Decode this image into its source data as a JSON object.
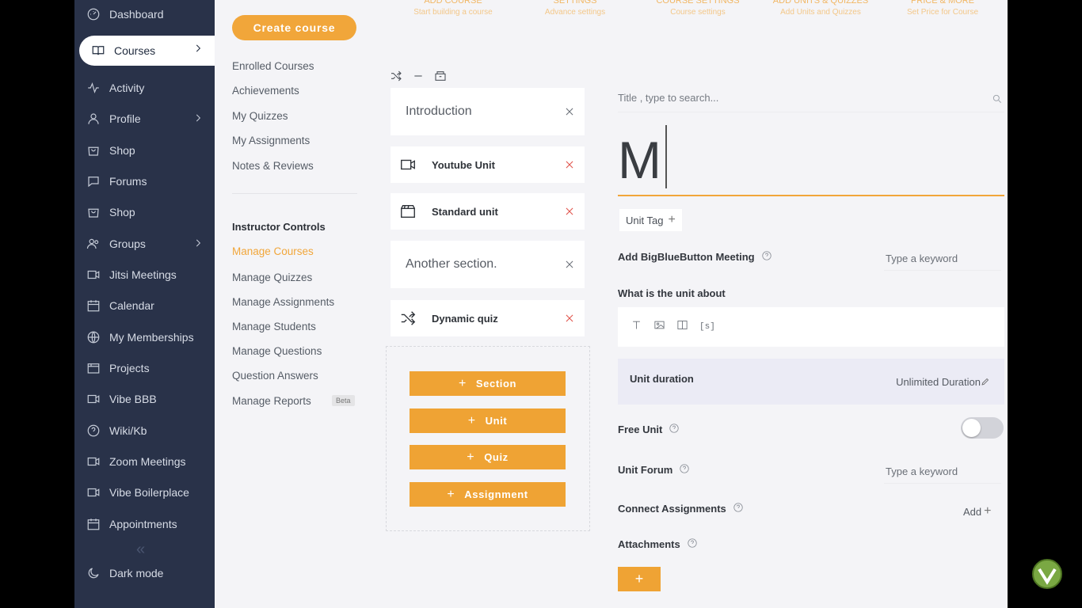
{
  "sidebar": {
    "items": [
      {
        "label": "Dashboard",
        "icon": "dashboard-icon"
      },
      {
        "label": "Courses",
        "icon": "book-icon",
        "chevron": true,
        "active": true
      },
      {
        "label": "Activity",
        "icon": "activity-icon"
      },
      {
        "label": "Profile",
        "icon": "user-icon",
        "chevron": true
      },
      {
        "label": "Shop",
        "icon": "shop-icon"
      },
      {
        "label": "Forums",
        "icon": "chat-icon"
      },
      {
        "label": "Shop",
        "icon": "shop-icon"
      },
      {
        "label": "Groups",
        "icon": "group-icon",
        "chevron": true
      },
      {
        "label": "Jitsi Meetings",
        "icon": "video-icon"
      },
      {
        "label": "Calendar",
        "icon": "calendar-icon"
      },
      {
        "label": "My Memberships",
        "icon": "globe-icon"
      },
      {
        "label": "Projects",
        "icon": "projects-icon"
      },
      {
        "label": "Vibe BBB",
        "icon": "video-icon"
      },
      {
        "label": "Wiki/Kb",
        "icon": "help-circle-icon"
      },
      {
        "label": "Zoom Meetings",
        "icon": "video-icon"
      },
      {
        "label": "Vibe Boilerplace",
        "icon": "video-icon"
      },
      {
        "label": "Appointments",
        "icon": "calendar-icon"
      }
    ],
    "collapse_glyph": "«",
    "dark_mode": "Dark mode"
  },
  "submenu": {
    "create_course": "Create course",
    "links": [
      "Enrolled Courses",
      "Achievements",
      "My Quizzes",
      "My Assignments",
      "Notes & Reviews"
    ],
    "instructor_heading": "Instructor Controls",
    "instructor_links": [
      "Manage Courses",
      "Manage Quizzes",
      "Manage Assignments",
      "Manage Students",
      "Manage Questions",
      "Question Answers",
      "Manage Reports"
    ],
    "active_link": "Manage Courses",
    "beta": "Beta"
  },
  "steps": [
    {
      "title": "ADD COURSE",
      "subtitle": "Start building a course"
    },
    {
      "title": "SETTINGS",
      "subtitle": "Advance settings"
    },
    {
      "title": "COURSE SETTINGS",
      "subtitle": "Course settings"
    },
    {
      "title": "ADD UNITS & QUIZZES",
      "subtitle": "Add Units and Quizzes"
    },
    {
      "title": "PRICE & MORE",
      "subtitle": "Set Price for Course"
    }
  ],
  "curriculum": {
    "items": [
      {
        "type": "section",
        "label": "Introduction"
      },
      {
        "type": "unit",
        "label": "Youtube Unit",
        "icon": "video-icon"
      },
      {
        "type": "unit",
        "label": "Standard unit",
        "icon": "clapper-icon"
      },
      {
        "type": "section",
        "label": "Another section."
      },
      {
        "type": "unit",
        "label": "Dynamic quiz",
        "icon": "shuffle-icon"
      }
    ],
    "add_buttons": [
      "Section",
      "Unit",
      "Quiz",
      "Assignment"
    ]
  },
  "form": {
    "search_placeholder": "Title , type to search...",
    "title_value": "M",
    "unit_tag": "Unit Tag",
    "bbb_label": "Add BigBlueButton Meeting",
    "keyword_placeholder": "Type a keyword",
    "about_label": "What is the unit about",
    "editor_tools": [
      "text-icon",
      "image-icon",
      "columns-icon",
      "shortcode-icon"
    ],
    "shortcode_glyph": "[s]",
    "duration_label": "Unit duration",
    "duration_value": "Unlimited Duration",
    "free_unit_label": "Free Unit",
    "free_unit_on": false,
    "forum_label": "Unit Forum",
    "connect_label": "Connect Assignments",
    "add_label": "Add",
    "attachments_label": "Attachments"
  },
  "colors": {
    "accent": "#f1a63a",
    "sidebar": "#293249",
    "danger": "#e0544c"
  }
}
